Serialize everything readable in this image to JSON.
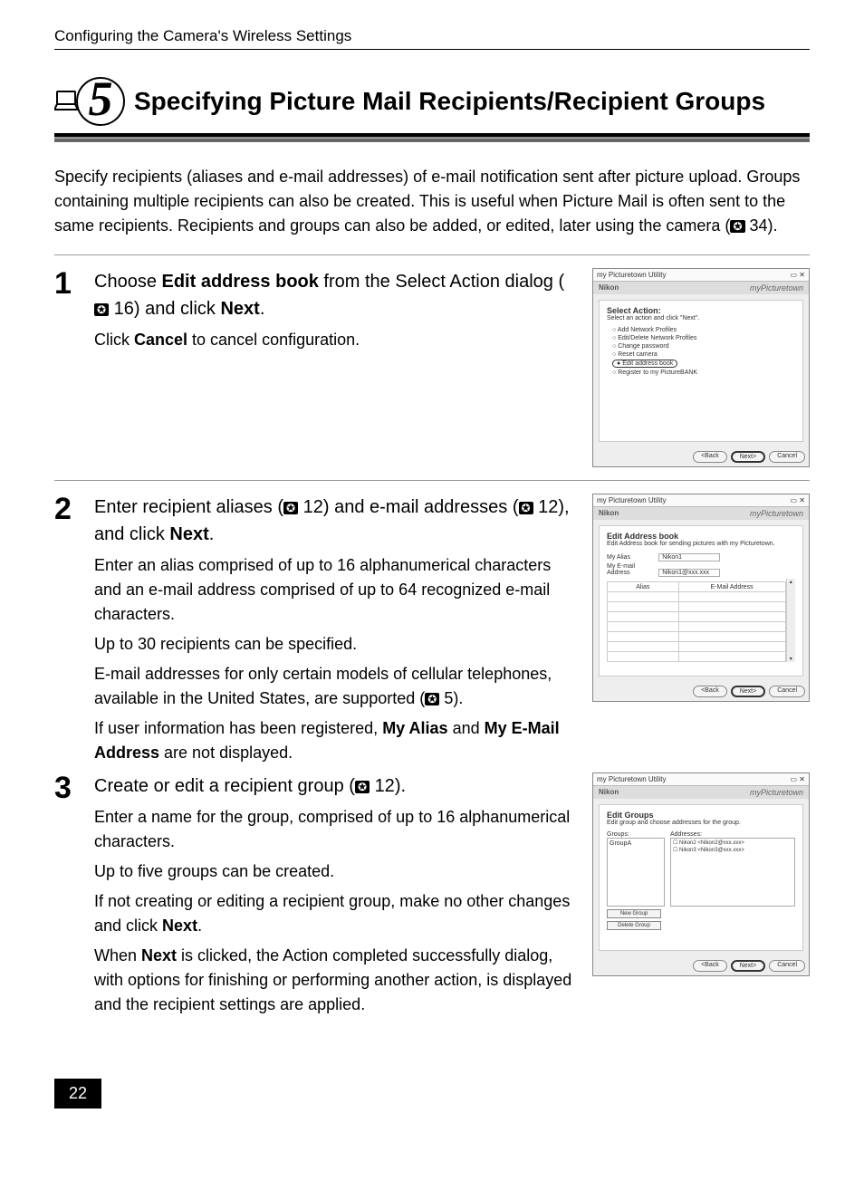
{
  "header": "Configuring the Camera's Wireless Settings",
  "step_badge": "5",
  "title": "Specifying Picture Mail Recipients/Recipient Groups",
  "intro_parts": {
    "p1": "Specify recipients (aliases and e-mail addresses) of e-mail notification sent after picture upload. Groups containing multiple recipients can also be created. This is useful when Picture Mail is often sent to the same recipients. Recipients and groups can also be added, or edited, later using the camera (",
    "ref1": "34",
    "p2": ")."
  },
  "steps": [
    {
      "num": "1",
      "lead": {
        "t1": "Choose ",
        "b1": "Edit address book",
        "t2": " from the Select Action dialog (",
        "ref1": "16",
        "t3": ") and click ",
        "b2": "Next",
        "t4": "."
      },
      "body_parts": {
        "t1": "Click ",
        "b1": "Cancel",
        "t2": " to cancel configuration."
      }
    },
    {
      "num": "2",
      "lead": {
        "t1": "Enter recipient aliases (",
        "ref1": "12",
        "t2": ") and e-mail addresses (",
        "ref2": "12",
        "t3": "), and click ",
        "b1": "Next",
        "t4": "."
      },
      "body_lines": [
        "Enter an alias comprised of up to 16 alphanumerical characters and an e-mail address comprised of up to 64 recognized e-mail characters.",
        "Up to 30 recipients can be specified."
      ],
      "body_parts_3": {
        "t1": "E-mail addresses for only certain models of cellular telephones, available in the United States, are supported (",
        "ref1": "5",
        "t2": ")."
      },
      "body_parts_4": {
        "t1": "If user information has been registered, ",
        "b1": "My Alias",
        "t2": " and ",
        "b2": "My E-Mail Address",
        "t3": " are not displayed."
      }
    },
    {
      "num": "3",
      "lead": {
        "t1": "Create or edit a recipient group (",
        "ref1": "12",
        "t2": ")."
      },
      "body_lines": [
        "Enter a name for the group, comprised of up to 16 alphanumerical characters.",
        "Up to five groups can be created."
      ],
      "body_parts_3": {
        "t1": "If not creating or editing a recipient group, make no other changes and click ",
        "b1": "Next",
        "t2": "."
      },
      "body_parts_4": {
        "t1": "When ",
        "b1": "Next",
        "t2": " is clicked, the Action completed successfully dialog, with options for finishing or performing another action, is displayed and the recipient settings are applied."
      }
    }
  ],
  "thumbs": {
    "app_title": "my Picturetown Utility",
    "brand": "myPicturetown",
    "nikon": "Nikon",
    "back": "<Back",
    "next": "Next>",
    "cancel": "Cancel",
    "win1": {
      "heading": "Select Action:",
      "sub": "Select an action and click \"Next\".",
      "opts": [
        "Add Network Profiles",
        "Edit/Delete Network Profiles",
        "Change password",
        "Reset camera",
        "Edit address book",
        "Register to my PictureBANK"
      ],
      "selected_index": 4
    },
    "win2": {
      "heading": "Edit Address book",
      "sub": "Edit Address book for sending pictures with my Picturetown.",
      "row1_label": "My Alias",
      "row1_value": "Nikon1",
      "row2_label": "My E-mail Address",
      "row2_value": "Nikon1@xxx.xxx",
      "col_alias": "Alias",
      "col_email": "E-Mail Address"
    },
    "win3": {
      "heading": "Edit Groups",
      "sub": "Edit group and choose addresses for the group.",
      "groups_label": "Groups:",
      "addresses_label": "Addresses:",
      "group_item": "GroupA",
      "addr1": "Nikon2 <Nikon2@xxx.xxx>",
      "addr2": "Nikon3 <Nikon3@xxx.xxx>",
      "btn_new": "New Group",
      "btn_del": "Delete Group"
    }
  },
  "page_number": "22"
}
